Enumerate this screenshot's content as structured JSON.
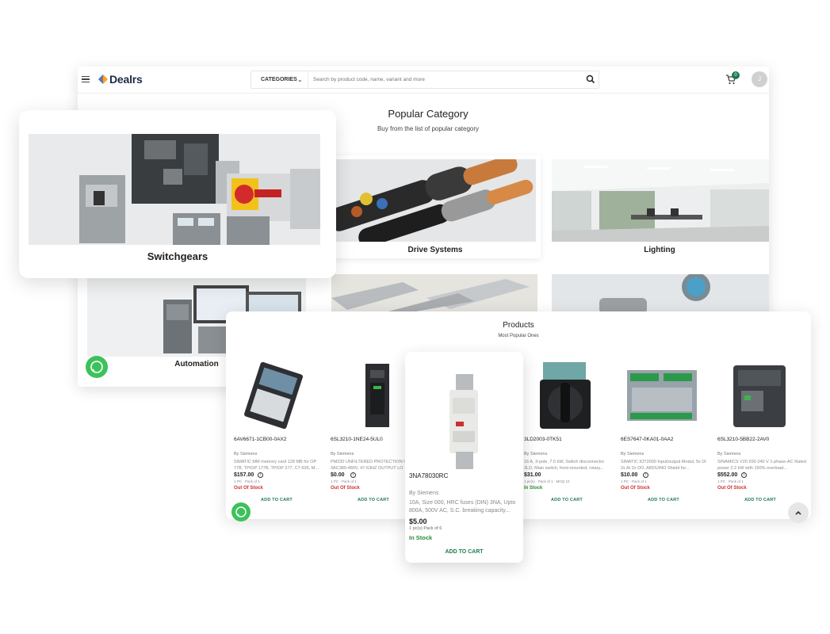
{
  "header": {
    "logo_text": "Dealrs",
    "categories_label": "CATEGORIES",
    "search_placeholder": "Search by product code, name, variant and more",
    "cart_count": "0",
    "avatar_initial": "J"
  },
  "popular_category": {
    "title": "Popular Category",
    "subtitle": "Buy from the list of popular category",
    "categories": [
      {
        "label": "Switchgears"
      },
      {
        "label": "Drive Systems"
      },
      {
        "label": "Lighting"
      },
      {
        "label": "Automation"
      }
    ]
  },
  "products": {
    "title": "Products",
    "subtitle": "Most Popular Ones",
    "add_to_cart_label": "ADD TO CART",
    "items": [
      {
        "code": "6AV6671-1CB00-0AX2",
        "by": "By Siemens",
        "desc": "SIMATIC MM memory card 128 MB for OP 77B, TP/OP 177B, TP/OP 277, C7-635, M...",
        "price": "$157.00",
        "pack": "1 PC  ·  Pack of 1",
        "stock": "Out Of Stock"
      },
      {
        "code": "6SL3210-1NE24-5UL0",
        "by": "By Siemens",
        "desc": "PM230 UNFILTERED PROTECTION IP 3AC380-480V, 47-63HZ OUTPUT LO",
        "price": "$0.00",
        "pack": "1 PC  ·  Pack of 1",
        "stock": "Out Of Stock"
      },
      {
        "code": "3LD2003-0TK51",
        "by": "By Siemens",
        "desc": "16 A, 3-pole, 7.5 kW, Switch disconnector 3LD, Main switch, front-mounted, rotary...",
        "price": "$31.00",
        "pack": "1 pc(s)  ·  Pack of 1  ·  MOQ 10",
        "stock": "In Stock"
      },
      {
        "code": "6ES7647-0KA01-0AA2",
        "by": "By Siemens",
        "desc": "SIMATIC IOT2000 Input/output Modul, 5x DI 2x AI 2x DO, ARDUINO Shield for...",
        "price": "$10.00",
        "pack": "1 PC  ·  Pack of 1",
        "stock": "Out Of Stock"
      },
      {
        "code": "6SL3210-5BB22-2AV0",
        "by": "By Siemens",
        "desc": "SINAMICS V20 200-240 V 1-phase-AC Rated power 2.2 kW with 150% overload...",
        "price": "$552.00",
        "pack": "1 PC  ·  Pack of 1",
        "stock": "Out Of Stock"
      }
    ],
    "featured": {
      "code": "3NA78030RC",
      "by": "By Siemens",
      "desc": "10A, Size 000, HRC fuses (DIN) 3NA, Upto 800A, 500V AC, S.C. breaking capacity...",
      "price": "$5.00",
      "pack": "1 pc(s)    Pack of 6",
      "stock": "In Stock"
    }
  },
  "colors": {
    "brand_green": "#1e7a4f",
    "out_of_stock": "#d32f2f",
    "in_stock": "#2e8b3d",
    "whatsapp": "#3cc25b"
  }
}
